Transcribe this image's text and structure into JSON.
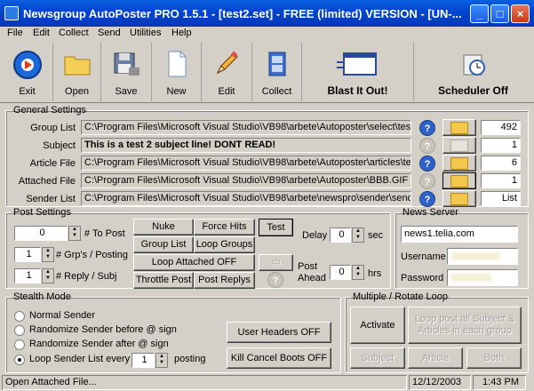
{
  "window": {
    "title": "Newsgroup AutoPoster PRO 1.5.1 - [test2.set] - FREE (limited) VERSION - [UN-...",
    "minimize": "_",
    "maximize": "□",
    "close": "×"
  },
  "menu": [
    "File",
    "Edit",
    "Collect",
    "Send",
    "Utilities",
    "Help"
  ],
  "toolbar": {
    "exit": "Exit",
    "open": "Open",
    "save": "Save",
    "new": "New",
    "edit": "Edit",
    "collect": "Collect",
    "blast": "Blast It Out!",
    "scheduler": "Scheduler Off"
  },
  "general": {
    "legend": "General Settings",
    "rows": [
      {
        "label": "Group List",
        "value": "C:\\Program Files\\Microsoft Visual Studio\\VB98\\arbete\\Autoposter\\select\\test",
        "count": "492"
      },
      {
        "label": "Subject",
        "value": "This is a test 2 subject line! DONT READ!",
        "count": "1"
      },
      {
        "label": "Article File",
        "value": "C:\\Program Files\\Microsoft Visual Studio\\VB98\\arbete\\Autoposter\\articles\\te",
        "count": "6"
      },
      {
        "label": "Attached File",
        "value": "C:\\Program Files\\Microsoft Visual Studio\\VB98\\arbete\\Autoposter\\BBB.GIF",
        "count": "1"
      },
      {
        "label": "Sender List",
        "value": "C:\\Program Files\\Microsoft Visual Studio\\VB98\\arbete\\newspro\\sender\\send",
        "count": "List"
      }
    ]
  },
  "post": {
    "legend": "Post Settings",
    "to_post_value": "0",
    "to_post_label": "# To Post",
    "grps_value": "1",
    "grps_label": "# Grp's / Posting",
    "reply_value": "1",
    "reply_label": "# Reply / Subj",
    "nuke": "Nuke",
    "force_hits": "Force Hits",
    "test": "Test",
    "group_list": "Group List",
    "loop_groups": "Loop Groups",
    "loop_attached": "Loop Attached OFF",
    "throttle": "Throttle Post",
    "post_replys": "Post Replys",
    "delay_label": "Delay",
    "delay_value": "0",
    "delay_unit": "sec",
    "post_ahead_label": "Post Ahead",
    "post_ahead_value": "0",
    "post_ahead_unit": "hrs"
  },
  "news": {
    "legend": "News Server",
    "server": "news1.telia.com",
    "username_label": "Username",
    "password_label": "Password"
  },
  "stealth": {
    "legend": "Stealth Mode",
    "options": [
      "Normal Sender",
      "Randomize Sender before @ sign",
      "Randomize Sender after @ sign",
      "Loop Sender List every"
    ],
    "loop_value": "1",
    "posting_label": "posting",
    "user_headers": "User Headers OFF",
    "kill_cancel": "Kill Cancel Boots OFF"
  },
  "loop": {
    "legend": "Multiple / Rotate Loop",
    "activate": "Activate",
    "loop_all": "Loop post all Subject & Articles in each group",
    "subject": "Subject",
    "article": "Article",
    "both": "Both"
  },
  "status": {
    "left": "Open Attached File...",
    "date": "12/12/2003",
    "time": "1:43 PM"
  }
}
